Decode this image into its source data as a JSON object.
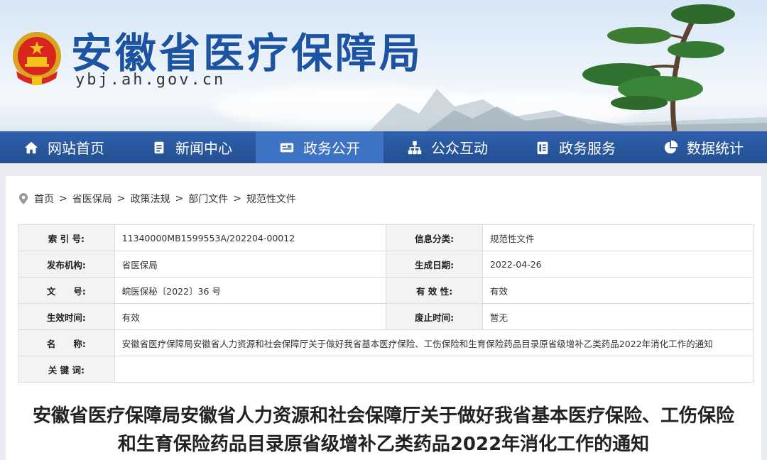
{
  "site": {
    "title": "安徽省医疗保障局",
    "domain": "ybj.ah.gov.cn"
  },
  "nav": [
    {
      "label": "网站首页",
      "icon": "home-icon"
    },
    {
      "label": "新闻中心",
      "icon": "document-icon"
    },
    {
      "label": "政务公开",
      "icon": "id-card-icon",
      "active": true
    },
    {
      "label": "公众互动",
      "icon": "network-icon"
    },
    {
      "label": "政务服务",
      "icon": "clipboard-icon"
    },
    {
      "label": "数据统计",
      "icon": "pie-chart-icon"
    }
  ],
  "breadcrumb": [
    "首页",
    "省医保局",
    "政策法规",
    "部门文件",
    "规范性文件"
  ],
  "meta": {
    "index_label": "索 引 号:",
    "index_value": "11340000MB1599553A/202204-00012",
    "category_label": "信息分类:",
    "category_value": "规范性文件",
    "publisher_label": "发布机构:",
    "publisher_value": "省医保局",
    "date_label": "生成日期:",
    "date_value": "2022-04-26",
    "docno_label": "文　　号:",
    "docno_value": "皖医保秘〔2022〕36 号",
    "validity_label": "有 效 性:",
    "validity_value": "有效",
    "effective_label": "生效时间:",
    "effective_value": "有效",
    "expiry_label": "废止时间:",
    "expiry_value": "暂无",
    "name_label": "名　　称:",
    "name_value": "安徽省医疗保障局安徽省人力资源和社会保障厅关于做好我省基本医疗保险、工伤保险和生育保险药品目录原省级增补乙类药品2022年消化工作的通知",
    "keywords_label": "关 键 词:",
    "keywords_value": ""
  },
  "document": {
    "title": "安徽省医疗保障局安徽省人力资源和社会保障厅关于做好我省基本医疗保险、工伤保险和生育保险药品目录原省级增补乙类药品2022年消化工作的通知"
  },
  "colors": {
    "nav_bg": "#2a579f",
    "nav_active": "#3e73c4",
    "title_blue": "#1c53a3"
  }
}
